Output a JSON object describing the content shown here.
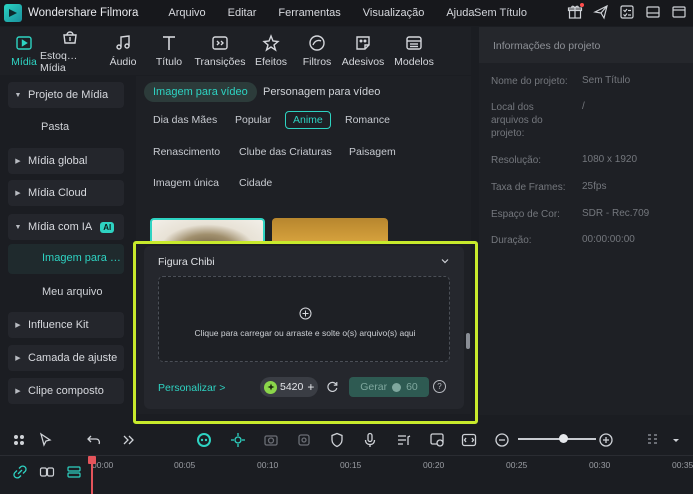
{
  "app": {
    "name": "Wondershare Filmora",
    "project_title": "Sem Título"
  },
  "menu": [
    "Arquivo",
    "Editar",
    "Ferramentas",
    "Visualização",
    "Ajuda"
  ],
  "media_tabs": [
    {
      "label": "Mídia",
      "icon": "media-icon"
    },
    {
      "label": "Estoq…Mídia",
      "icon": "stock-media-icon"
    },
    {
      "label": "Áudio",
      "icon": "music-note-icon"
    },
    {
      "label": "Título",
      "icon": "text-icon"
    },
    {
      "label": "Transições",
      "icon": "transition-icon"
    },
    {
      "label": "Efeitos",
      "icon": "effects-icon"
    },
    {
      "label": "Filtros",
      "icon": "filter-icon"
    },
    {
      "label": "Adesivos",
      "icon": "sticker-icon"
    },
    {
      "label": "Modelos",
      "icon": "template-icon"
    }
  ],
  "sidebar": {
    "items": [
      {
        "label": "Projeto de Mídia"
      },
      {
        "label": "Pasta"
      },
      {
        "label": "Mídia global"
      },
      {
        "label": "Mídia Cloud"
      },
      {
        "label": "Mídia com IA",
        "badge": "AI"
      },
      {
        "label": "Imagem para …"
      },
      {
        "label": "Meu arquivo"
      },
      {
        "label": "Influence Kit"
      },
      {
        "label": "Camada de ajuste"
      },
      {
        "label": "Clipe composto"
      }
    ]
  },
  "content": {
    "subtabs": [
      "Imagem para vídeo",
      "Personagem para vídeo"
    ],
    "tags": [
      "Dia das Mães",
      "Popular",
      "Anime",
      "Romance",
      "Renascimento",
      "Clube das Criaturas",
      "Paisagem",
      "Imagem única",
      "Cidade"
    ],
    "selected_tag": "Anime"
  },
  "popup": {
    "title": "Figura Chibi",
    "dropzone_text": "Clique para carregar ou arraste e solte o(s) arquivo(s) aqui",
    "personalize": "Personalizar >",
    "credits": "5420",
    "generate_label": "Gerar",
    "generate_cost": "60",
    "help": "?"
  },
  "project_info": {
    "title": "Informações do projeto",
    "rows": [
      {
        "label": "Nome do projeto:",
        "value": "Sem Título"
      },
      {
        "label": "Local dos arquivos do projeto:",
        "value": "/"
      },
      {
        "label": "Resolução:",
        "value": "1080 x 1920"
      },
      {
        "label": "Taxa de Frames:",
        "value": "25fps"
      },
      {
        "label": "Espaço de Cor:",
        "value": "SDR - Rec.709"
      },
      {
        "label": "Duração:",
        "value": "00:00:00:00"
      }
    ]
  },
  "timeline": {
    "ruler": [
      "00:00",
      "00:05",
      "00:10",
      "00:15",
      "00:20",
      "00:25",
      "00:30",
      "00:35"
    ]
  },
  "colors": {
    "accent": "#2ed3c2",
    "highlight": "#c8ea2c",
    "playhead": "#e4545b"
  }
}
